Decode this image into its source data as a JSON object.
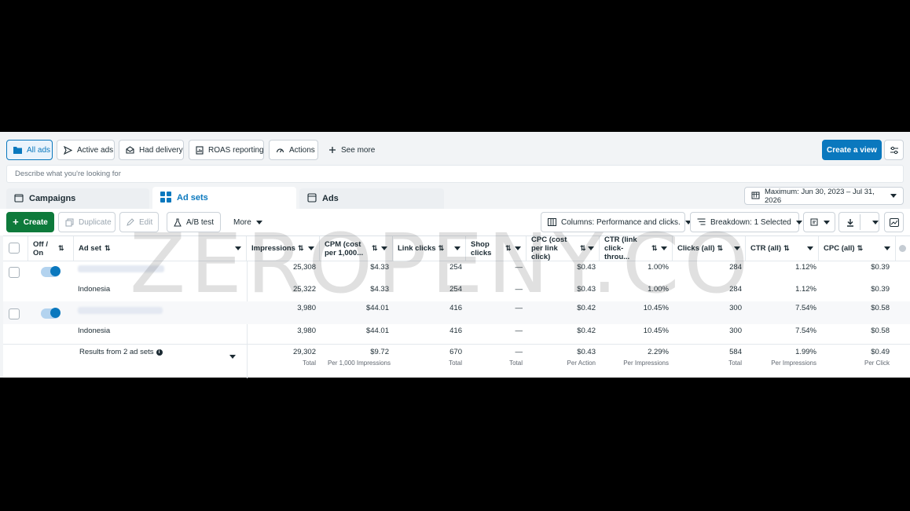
{
  "tabs": [
    {
      "label": "All ads",
      "icon": "folder-icon",
      "selected": true
    },
    {
      "label": "Active ads",
      "icon": "send-icon"
    },
    {
      "label": "Had delivery",
      "icon": "envelope-icon"
    },
    {
      "label": "ROAS reporting",
      "icon": "report-icon"
    },
    {
      "label": "Actions",
      "icon": "gauge-icon"
    },
    {
      "label": "See more",
      "icon": "plus-icon"
    }
  ],
  "create_view_label": "Create a view",
  "search_placeholder": "Describe what you're looking for",
  "levels": [
    {
      "label": "Campaigns",
      "icon": "campaign-icon"
    },
    {
      "label": "Ad sets",
      "icon": "grid-icon",
      "selected": true
    },
    {
      "label": "Ads",
      "icon": "ad-icon"
    }
  ],
  "date_range": "Maximum: Jun 30, 2023 – Jul 31, 2026",
  "toolbar": {
    "create": "Create",
    "duplicate": "Duplicate",
    "edit": "Edit",
    "ab_test": "A/B test",
    "more": "More",
    "columns": "Columns: Performance and clicks.",
    "breakdown": "Breakdown: 1 Selected"
  },
  "columns": {
    "off_on": "Off / On",
    "ad_set": "Ad set",
    "impressions": "Impressions",
    "cpm": "CPM (cost per 1,000...",
    "link_clicks": "Link clicks",
    "shop_clicks": "Shop clicks",
    "cpc_link": "CPC (cost per link click)",
    "ctr_link": "CTR (link click-throu...",
    "clicks_all": "Clicks (all)",
    "ctr_all": "CTR (all)",
    "cpc_all": "CPC (all)"
  },
  "rows": [
    {
      "type": "adset",
      "impressions": "25,308",
      "cpm": "$4.33",
      "link_clicks": "254",
      "shop_clicks": "—",
      "cpc_link": "$0.43",
      "ctr_link": "1.00%",
      "clicks_all": "284",
      "ctr_all": "1.12%",
      "cpc_all": "$0.39"
    },
    {
      "type": "breakdown",
      "name": "Indonesia",
      "impressions": "25,322",
      "cpm": "$4.33",
      "link_clicks": "254",
      "shop_clicks": "—",
      "cpc_link": "$0.43",
      "ctr_link": "1.00%",
      "clicks_all": "284",
      "ctr_all": "1.12%",
      "cpc_all": "$0.39"
    },
    {
      "type": "adset",
      "impressions": "3,980",
      "cpm": "$44.01",
      "link_clicks": "416",
      "shop_clicks": "—",
      "cpc_link": "$0.42",
      "ctr_link": "10.45%",
      "clicks_all": "300",
      "ctr_all": "7.54%",
      "cpc_all": "$0.58"
    },
    {
      "type": "breakdown",
      "name": "Indonesia",
      "impressions": "3,980",
      "cpm": "$44.01",
      "link_clicks": "416",
      "shop_clicks": "—",
      "cpc_link": "$0.42",
      "ctr_link": "10.45%",
      "clicks_all": "300",
      "ctr_all": "7.54%",
      "cpc_all": "$0.58"
    }
  ],
  "totals": {
    "label": "Results from 2 ad sets",
    "impressions": "29,302",
    "impressions_sub": "Total",
    "cpm": "$9.72",
    "cpm_sub": "Per 1,000 Impressions",
    "link_clicks": "670",
    "link_clicks_sub": "Total",
    "shop_clicks": "—",
    "shop_clicks_sub": "Total",
    "cpc_link": "$0.43",
    "cpc_link_sub": "Per Action",
    "ctr_link": "2.29%",
    "ctr_link_sub": "Per Impressions",
    "clicks_all": "584",
    "clicks_all_sub": "Total",
    "ctr_all": "1.99%",
    "ctr_all_sub": "Per Impressions",
    "cpc_all": "$0.49",
    "cpc_all_sub": "Per Click"
  },
  "watermark": "ZEROPENY.CO",
  "colors": {
    "accent": "#0a78be",
    "create_green": "#0e7a3b",
    "background": "#000000"
  }
}
